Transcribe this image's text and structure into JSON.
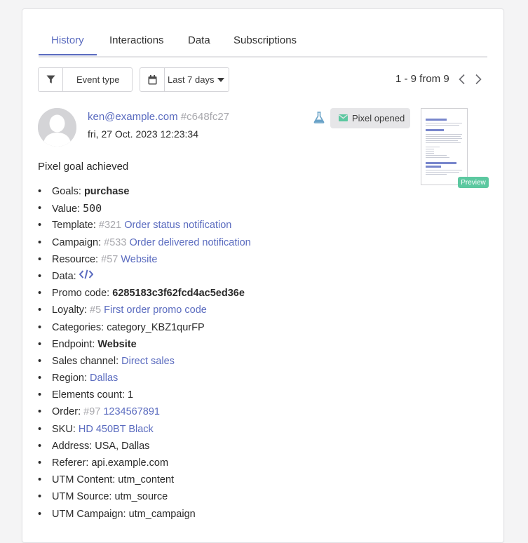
{
  "tabs": [
    {
      "label": "History",
      "active": true
    },
    {
      "label": "Interactions",
      "active": false
    },
    {
      "label": "Data",
      "active": false
    },
    {
      "label": "Subscriptions",
      "active": false
    }
  ],
  "filters": {
    "event_type_label": "Event type",
    "date_range_label": "Last 7 days"
  },
  "pagination": {
    "text": "1 - 9 from 9"
  },
  "event": {
    "email": "ken@example.com",
    "contact_hash": "#c648fc27",
    "date": "fri, 27 Oct. 2023 12:23:34",
    "status_label": "Pixel opened",
    "preview_label": "Preview",
    "summary": "Pixel goal achieved"
  },
  "fields": {
    "goals": {
      "label": "Goals: ",
      "value": "purchase"
    },
    "value": {
      "label": "Value: ",
      "value": "500"
    },
    "template": {
      "label": "Template: ",
      "id": "#321",
      "value": "Order status notification"
    },
    "campaign": {
      "label": "Campaign: ",
      "id": "#533",
      "value": "Order delivered notification"
    },
    "resource": {
      "label": "Resource: ",
      "id": "#57",
      "value": "Website"
    },
    "data": {
      "label": "Data: "
    },
    "promo": {
      "label": "Promo code: ",
      "value": "6285183c3f62fcd4ac5ed36e"
    },
    "loyalty": {
      "label": "Loyalty: ",
      "id": "#5",
      "value": "First order promo code"
    },
    "categories": {
      "label": "Categories: ",
      "value": "category_KBZ1qurFP"
    },
    "endpoint": {
      "label": "Endpoint: ",
      "value": "Website"
    },
    "sales_channel": {
      "label": "Sales channel: ",
      "value": "Direct sales"
    },
    "region": {
      "label": "Region: ",
      "value": "Dallas"
    },
    "elements": {
      "label": "Elements count: ",
      "value": "1"
    },
    "order": {
      "label": "Order: ",
      "id": "#97",
      "value": "1234567891"
    },
    "sku": {
      "label": "SKU: ",
      "value": "HD 450BT Black"
    },
    "address": {
      "label": "Address: ",
      "value": "USA, Dallas"
    },
    "referer": {
      "label": "Referer: ",
      "value": "api.example.com"
    },
    "utm_content": {
      "label": "UTM Content: ",
      "value": "utm_content"
    },
    "utm_source": {
      "label": "UTM Source: ",
      "value": "utm_source"
    },
    "utm_campaign": {
      "label": "UTM Campaign: ",
      "value": "utm_campaign"
    }
  },
  "colors": {
    "accent": "#5a6bbf",
    "badge_bg": "#e6e6e8",
    "preview_badge": "#5cc8a0",
    "flask": "#6aa3c8",
    "envelope": "#5cc8a0"
  },
  "icons": [
    "filter-icon",
    "calendar-icon",
    "caret-down-icon",
    "chevron-left-icon",
    "chevron-right-icon",
    "flask-icon",
    "envelope-icon",
    "code-icon",
    "avatar-icon"
  ]
}
